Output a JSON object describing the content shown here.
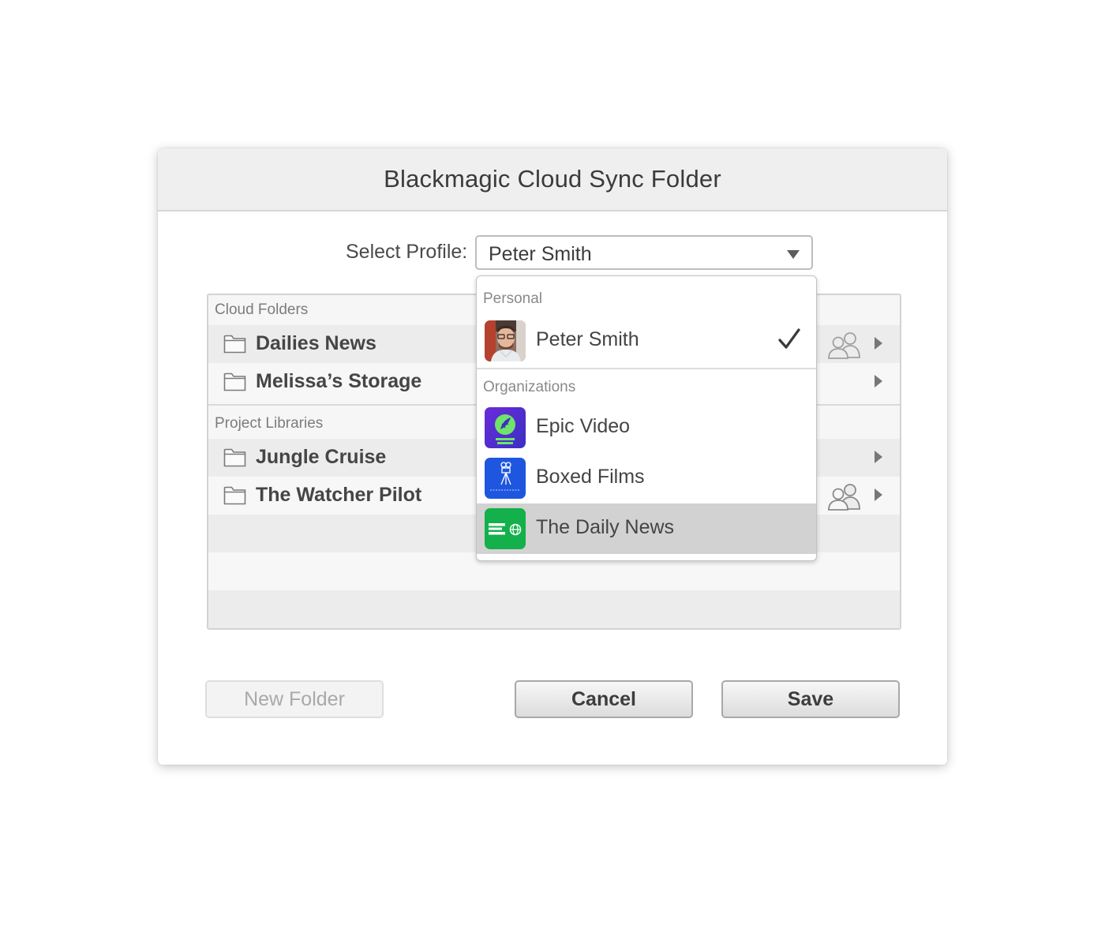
{
  "dialog": {
    "title": "Blackmagic Cloud Sync Folder",
    "profile_label": "Select Profile:",
    "profile_selected": "Peter Smith"
  },
  "cloud_folders": {
    "label": "Cloud Folders",
    "items": [
      {
        "name": "Dailies News",
        "shared": true
      },
      {
        "name": "Melissa’s Storage",
        "shared": false
      }
    ]
  },
  "project_libraries": {
    "label": "Project Libraries",
    "items": [
      {
        "name": "Jungle Cruise",
        "shared": false
      },
      {
        "name": "The Watcher Pilot",
        "shared": true
      }
    ]
  },
  "dropdown": {
    "personal_label": "Personal",
    "personal_items": [
      {
        "name": "Peter Smith",
        "selected": true,
        "avatar": "photo-avatar"
      }
    ],
    "organizations_label": "Organizations",
    "organization_items": [
      {
        "name": "Epic Video",
        "avatar_text": "EPIC VIDEO",
        "color": "#5a2fd0"
      },
      {
        "name": "Boxed Films",
        "avatar_text": "Boxed Films",
        "color": "#1f56e0"
      },
      {
        "name": "The Daily News",
        "avatar_text": "DAILY NEWS",
        "color": "#13b04b",
        "hovered": true
      }
    ]
  },
  "buttons": {
    "new_folder": "New Folder",
    "cancel": "Cancel",
    "save": "Save"
  },
  "icons": {
    "folder": "folder-icon",
    "shared": "people-icon",
    "expand": "chevron-right-icon",
    "check": "checkmark-icon",
    "caret": "caret-down-icon"
  }
}
